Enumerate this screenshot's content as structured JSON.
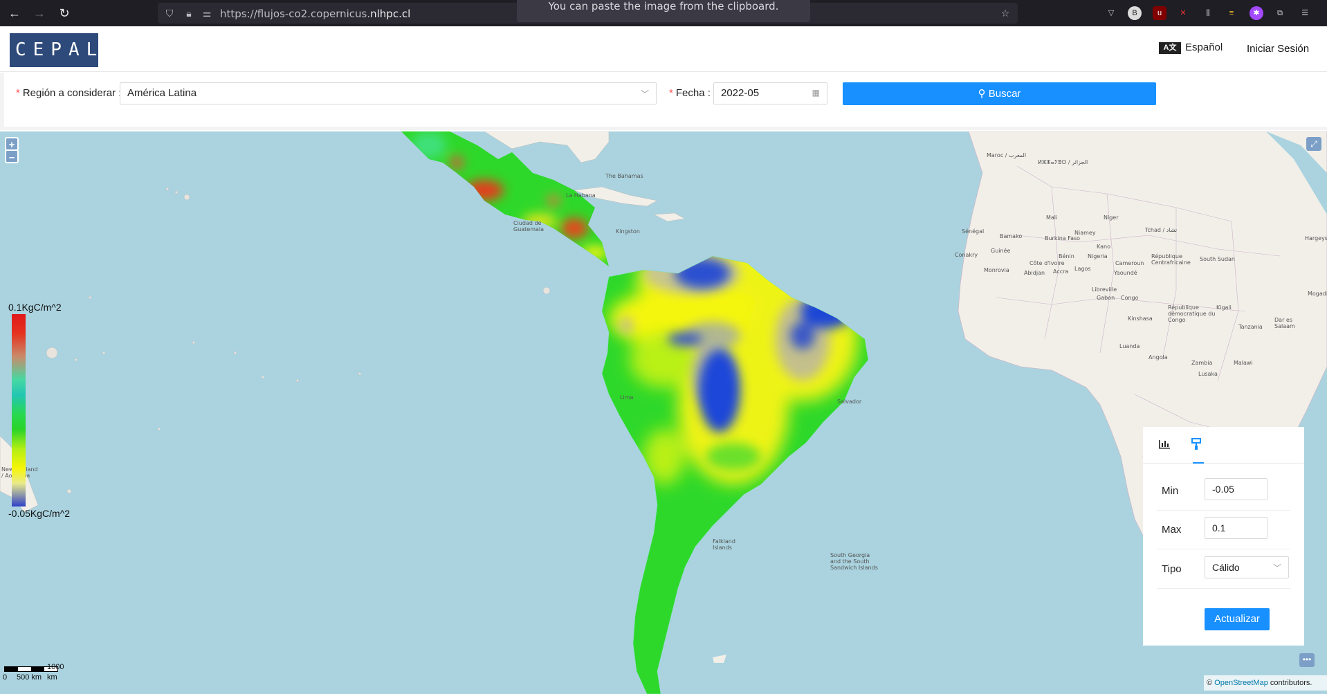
{
  "browser": {
    "url_prefix": "https://flujos-co2.copernicus.",
    "url_domain": "nlhpc.cl",
    "paste_tooltip": "You can paste the image from the clipboard."
  },
  "header": {
    "logo_text": "CEPAL",
    "language_icon": "A文",
    "language_label": "Español",
    "login_label": "Iniciar Sesión"
  },
  "filters": {
    "region_label": "Región a considerar",
    "region_value": "América Latina",
    "date_label": "Fecha",
    "date_value": "2022-05",
    "search_label": "Buscar"
  },
  "map": {
    "zoom_in": "+",
    "zoom_out": "–",
    "legend_max": "0.1KgC/m^2",
    "legend_min": "-0.05KgC/m^2",
    "scale_labels": [
      "0",
      "500 km",
      "1000 km"
    ],
    "attribution_prefix": "©",
    "attribution_link": "OpenStreetMap",
    "attribution_suffix": "contributors.",
    "place_labels": [
      "La Habana",
      "The Bahamas",
      "Kingston",
      "Ciudad de Guatemala",
      "Lima",
      "Salvador",
      "Maroc / المغرب",
      "ⵍⵣⵣⴰⵢⴻⵔ / الجزائر",
      "Mali",
      "Niger",
      "Tchad / تشاد",
      "Sénégal",
      "Bamako",
      "Burkina Faso",
      "Niamey",
      "Kano",
      "Conakry",
      "Guinée",
      "Monrovia",
      "Côte d'Ivoire",
      "Abidjan",
      "Accra",
      "Bénin",
      "Nigeria",
      "Lagos",
      "Cameroun",
      "Yaoundé",
      "République Centrafricaine",
      "South Sudan",
      "Libreville",
      "Gabon",
      "Congo",
      "République démocratique du Congo",
      "Kinshasa",
      "Kigali",
      "Tanzania",
      "Dar es Salaam",
      "Luanda",
      "Angola",
      "Zambia",
      "Malawi",
      "Lusaka",
      "Mogadishu",
      "Hargeysa",
      "Falkland Islands",
      "South Georgia and the South Sandwich Islands",
      "New Zealand / Aotearoa"
    ]
  },
  "panel": {
    "tabs": [
      "chart-icon",
      "brush-icon"
    ],
    "min_label": "Min",
    "min_value": "-0.05",
    "max_label": "Max",
    "max_value": "0.1",
    "type_label": "Tipo",
    "type_value": "Cálido",
    "update_label": "Actualizar"
  },
  "colors": {
    "primary": "#1890ff",
    "ocean": "#aad3df",
    "land": "#f2efe9",
    "logo_bg": "#2d4a7a",
    "scale_high": "#e0191a",
    "scale_mid": "#2ad428",
    "scale_low": "#2f40c8"
  }
}
